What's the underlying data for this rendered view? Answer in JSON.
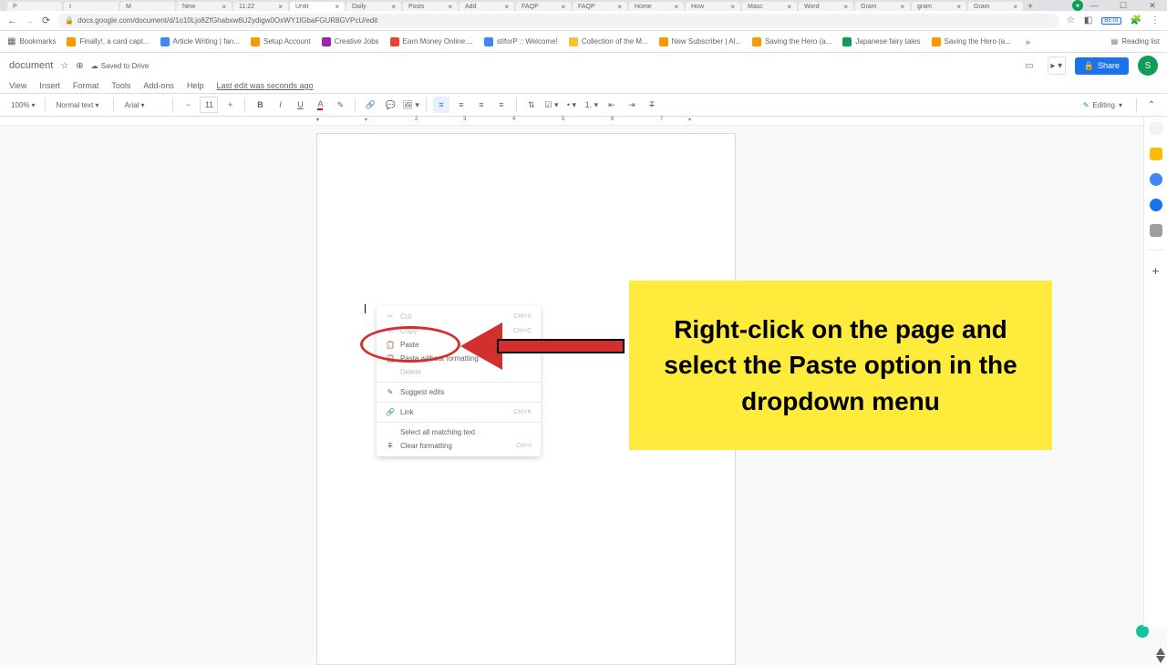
{
  "tabs": [
    {
      "label": "P"
    },
    {
      "label": "I"
    },
    {
      "label": "M"
    },
    {
      "label": "New"
    },
    {
      "label": "11:22"
    },
    {
      "label": "Untit"
    },
    {
      "label": "Daily"
    },
    {
      "label": "Posts"
    },
    {
      "label": "Add"
    },
    {
      "label": "FAQP"
    },
    {
      "label": "FAQP"
    },
    {
      "label": "Home"
    },
    {
      "label": "How"
    },
    {
      "label": "Masc"
    },
    {
      "label": "Word"
    },
    {
      "label": "Gram"
    },
    {
      "label": "gram"
    },
    {
      "label": "Gram"
    }
  ],
  "url": "docs.google.com/document/d/1o10Ljo8ZfGhabxw6U2ydigw0OxWY1lGbaFGUR8GVPcU/edit",
  "bookmarks": [
    {
      "label": "Bookmarks",
      "icon": "apps"
    },
    {
      "label": "Finally!, a card capt...",
      "icon": "orange"
    },
    {
      "label": "Article Writing | fan...",
      "icon": "blue"
    },
    {
      "label": "Setup Account",
      "icon": "orange"
    },
    {
      "label": "Creative Jobs",
      "icon": "purple"
    },
    {
      "label": "Earn Money Online:...",
      "icon": "red"
    },
    {
      "label": "stiforP :: Welcome!",
      "icon": "blue"
    },
    {
      "label": "Collection of the M...",
      "icon": "yellow"
    },
    {
      "label": "New Subscriber | Al...",
      "icon": "orange"
    },
    {
      "label": "Saving the Hero (a...",
      "icon": "orange"
    },
    {
      "label": "Japanese fairy tales",
      "icon": "green"
    },
    {
      "label": "Saving the Hero (a...",
      "icon": "orange"
    }
  ],
  "reading_list": "Reading list",
  "doc": {
    "title": "document",
    "saved": "Saved to Drive",
    "share": "Share",
    "avatar": "S"
  },
  "menus": [
    "View",
    "Insert",
    "Format",
    "Tools",
    "Add-ons",
    "Help"
  ],
  "last_edit": "Last edit was seconds ago",
  "toolbar": {
    "zoom": "100%",
    "style": "Normal text",
    "font": "Arial",
    "size": "11",
    "editing": "Editing"
  },
  "context": {
    "cut": "Cut",
    "cut_sc": "Ctrl+X",
    "copy": "Copy",
    "copy_sc": "Ctrl+C",
    "paste": "Paste",
    "paste_no": "Paste without formatting",
    "delete": "Delete",
    "suggest": "Suggest edits",
    "link": "Link",
    "link_sc": "Ctrl+K",
    "select_all": "Select all matching text",
    "clear_fmt": "Clear formatting",
    "clear_sc": "Ctrl+\\"
  },
  "callout": "Right-click on the page and select the Paste option in the dropdown menu",
  "beta": "BETA"
}
